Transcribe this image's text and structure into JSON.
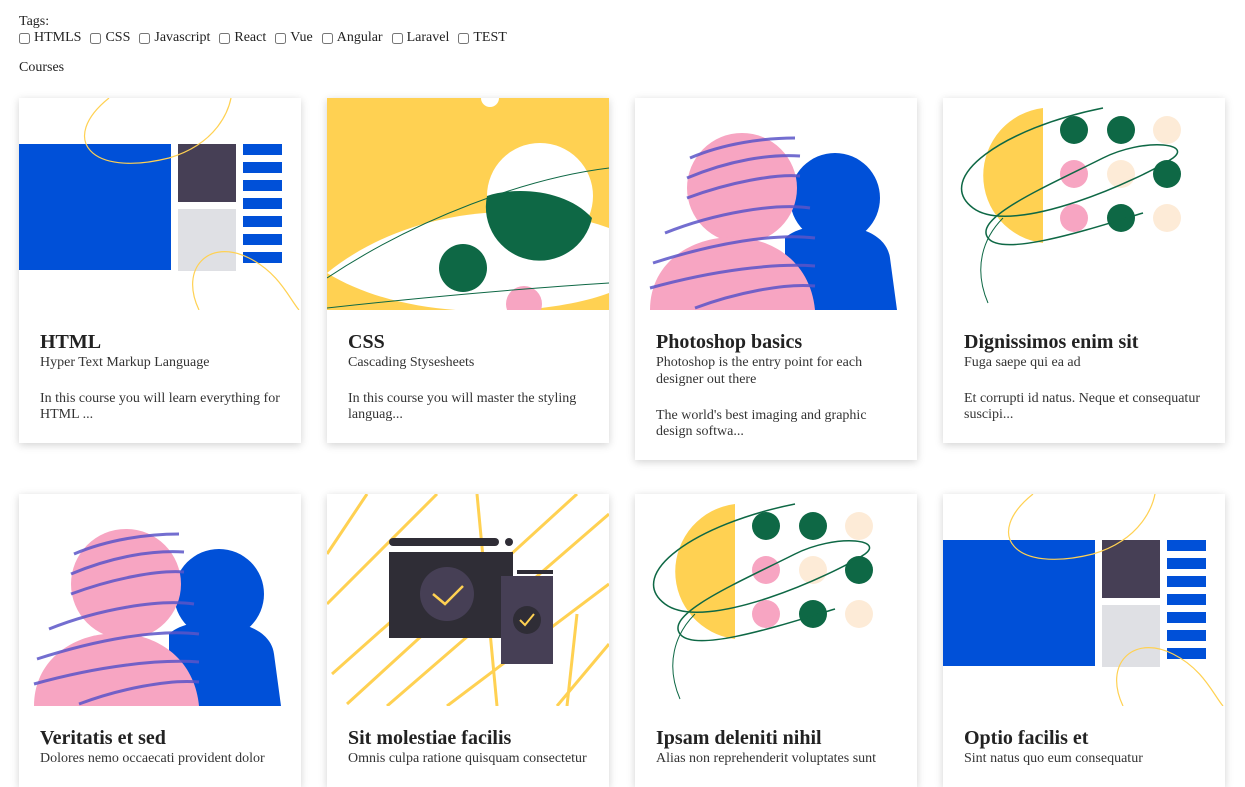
{
  "tags": {
    "label": "Tags:",
    "items": [
      "HTMLS",
      "CSS",
      "Javascript",
      "React",
      "Vue",
      "Angular",
      "Laravel",
      "TEST"
    ]
  },
  "courses_label": "Courses",
  "courses": [
    {
      "title": "HTML",
      "subtitle": "Hyper Text Markup Language",
      "description": "In this course you will learn everything for HTML ..."
    },
    {
      "title": "CSS",
      "subtitle": "Cascading Stysesheets",
      "description": "In this course you will master the styling languag..."
    },
    {
      "title": "Photoshop basics",
      "subtitle": "Photoshop is the entry point for each designer out there",
      "description": "The world's best imaging and graphic design softwa..."
    },
    {
      "title": "Dignissimos enim sit",
      "subtitle": "Fuga saepe qui ea ad",
      "description": "Et corrupti id natus. Neque et consequatur suscipi..."
    },
    {
      "title": "Veritatis et sed",
      "subtitle": "Dolores nemo occaecati provident dolor",
      "description": ""
    },
    {
      "title": "Sit molestiae facilis",
      "subtitle": "Omnis culpa ratione quisquam consectetur",
      "description": ""
    },
    {
      "title": "Ipsam deleniti nihil",
      "subtitle": "Alias non reprehenderit voluptates sunt",
      "description": ""
    },
    {
      "title": "Optio facilis et",
      "subtitle": "Sint natus quo eum consequatur",
      "description": ""
    }
  ],
  "colors": {
    "blue": "#0050d8",
    "dark": "#463f55",
    "grey": "#dfe0e4",
    "yellow": "#ffd152",
    "green": "#0e6845",
    "pink": "#f7a5c2",
    "cream": "#fdebd7"
  }
}
